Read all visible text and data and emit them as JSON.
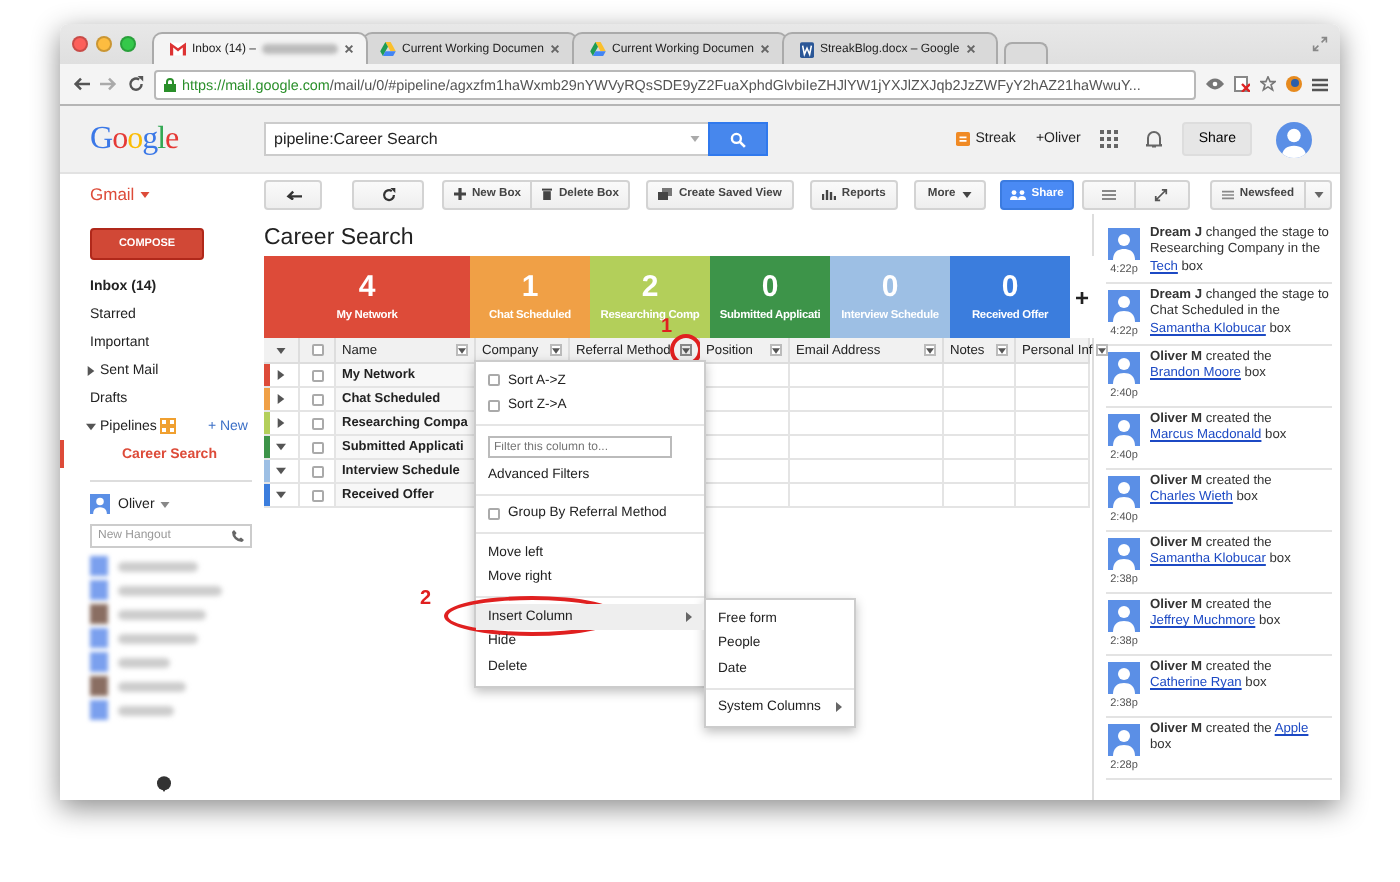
{
  "browser": {
    "tabs": [
      {
        "kind": "mail",
        "title": "Inbox (14) –",
        "selected": true
      },
      {
        "kind": "drive",
        "title": "Current Working Documen",
        "selected": false
      },
      {
        "kind": "drive",
        "title": "Current Working Documen",
        "selected": false
      },
      {
        "kind": "word",
        "title": "StreakBlog.docx – Google",
        "selected": false
      }
    ],
    "url_host": "https://mail.google.com",
    "url_path": "/mail/u/0/#pipeline/agxzfm1haWxmb29nYWVyRQsSDE9yZ2FuaXphdGlvbiIeZHJlYW1jYXJlZXJqb2JzZWFyY2hAZ21haWwuY..."
  },
  "header": {
    "logo": "Google",
    "search_value": "pipeline:Career Search",
    "streak": "Streak",
    "user_link": "+Oliver",
    "share": "Share"
  },
  "toolbar": {
    "app_menu": "Gmail",
    "buttons": [
      {
        "kind": "back"
      },
      {
        "kind": "refresh"
      },
      {
        "kind": "new",
        "label": "New Box"
      },
      {
        "kind": "delete",
        "label": "Delete Box"
      },
      {
        "kind": "view",
        "label": "Create Saved View"
      },
      {
        "kind": "reports",
        "label": "Reports"
      },
      {
        "kind": "more",
        "label": "More"
      },
      {
        "kind": "share",
        "label": "Share"
      },
      {
        "kind": "list"
      },
      {
        "kind": "expand"
      },
      {
        "kind": "newsfeed",
        "label": "Newsfeed"
      },
      {
        "kind": "dropdown"
      }
    ]
  },
  "sidebar": {
    "compose": "COMPOSE",
    "items": [
      {
        "label": "Inbox (14)",
        "unread": true,
        "selected": false
      },
      {
        "label": "Starred",
        "unread": false,
        "selected": false
      },
      {
        "label": "Important",
        "unread": false,
        "selected": false
      },
      {
        "label": "Sent Mail",
        "unread": false,
        "selected": false,
        "expanded": false
      },
      {
        "label": "Drafts",
        "unread": false,
        "selected": false
      }
    ],
    "pipelines": {
      "label": "Pipelines",
      "expanded": true,
      "new_link": "+ New",
      "children": [
        {
          "label": "Career Search",
          "selected": true
        }
      ]
    },
    "hangouts": {
      "user": "Oliver",
      "placeholder": "New Hangout"
    }
  },
  "pipeline": {
    "title": "Career Search",
    "add_stage": "+",
    "select_all": {
      "checked": false
    },
    "stages": [
      {
        "count": "4",
        "label": "My Network",
        "color": "#dd4b39"
      },
      {
        "count": "1",
        "label": "Chat Scheduled",
        "color": "#f0a046"
      },
      {
        "count": "2",
        "label": "Researching Comp",
        "color": "#b3cf5a"
      },
      {
        "count": "0",
        "label": "Submitted Applicati",
        "color": "#3d9449"
      },
      {
        "count": "0",
        "label": "Interview Schedule",
        "color": "#9dbfe4"
      },
      {
        "count": "0",
        "label": "Received Offer",
        "color": "#3b7ddd"
      }
    ],
    "columns": [
      {
        "label": "Name",
        "menu_open": false
      },
      {
        "label": "Company",
        "menu_open": false
      },
      {
        "label": "Referral Method",
        "menu_open": true
      },
      {
        "label": "Position",
        "menu_open": false
      },
      {
        "label": "Email Address",
        "menu_open": false
      },
      {
        "label": "Notes",
        "menu_open": false
      },
      {
        "label": "Personal Inf",
        "menu_open": false
      }
    ],
    "rows": [
      {
        "name": "My Network",
        "color": "#dd4b39",
        "expanded": false,
        "checked": false
      },
      {
        "name": "Chat Scheduled",
        "color": "#f0a046",
        "expanded": false,
        "checked": false
      },
      {
        "name": "Researching Compa",
        "color": "#b3cf5a",
        "expanded": false,
        "checked": false
      },
      {
        "name": "Submitted Applicati",
        "color": "#3d9449",
        "expanded": true,
        "checked": false
      },
      {
        "name": "Interview Schedule",
        "color": "#9dbfe4",
        "expanded": true,
        "checked": false
      },
      {
        "name": "Received Offer",
        "color": "#3b7ddd",
        "expanded": true,
        "checked": false
      }
    ],
    "column_menu": {
      "sections": [
        [
          {
            "kind": "check",
            "label": "Sort A->Z",
            "checked": false
          },
          {
            "kind": "check",
            "label": "Sort Z->A",
            "checked": false
          }
        ],
        [
          {
            "kind": "field",
            "placeholder": "Filter this column to..."
          },
          {
            "kind": "action",
            "label": "Advanced Filters",
            "highlighted": false
          }
        ],
        [
          {
            "kind": "check",
            "label": "Group By Referral Method",
            "checked": false
          }
        ],
        [
          {
            "kind": "action",
            "label": "Move left",
            "highlighted": false
          },
          {
            "kind": "action",
            "label": "Move right",
            "highlighted": false
          }
        ],
        [
          {
            "kind": "submenu",
            "label": "Insert Column",
            "highlighted": true
          },
          {
            "kind": "action",
            "label": "Hide",
            "highlighted": false
          },
          {
            "kind": "action",
            "label": "Delete",
            "highlighted": false
          }
        ]
      ]
    },
    "submenu": {
      "sections": [
        [
          {
            "kind": "action",
            "label": "Free form",
            "highlighted": false
          },
          {
            "kind": "action",
            "label": "People",
            "highlighted": false
          },
          {
            "kind": "action",
            "label": "Date",
            "highlighted": false
          }
        ],
        [
          {
            "kind": "submenu",
            "label": "System Columns",
            "highlighted": false
          }
        ]
      ]
    },
    "annotations": [
      {
        "kind": "circle",
        "label": "1"
      },
      {
        "kind": "ellipse",
        "label": "2"
      }
    ]
  },
  "feed": {
    "entries": [
      {
        "time": "4:22p",
        "actor": "Dream J",
        "action": " changed the stage to Researching Company in the ",
        "link": "Tech",
        "tail": " box"
      },
      {
        "time": "4:22p",
        "actor": "Dream J",
        "action": " changed the stage to Chat Scheduled in the ",
        "link": "Samantha Klobucar",
        "tail": " box"
      },
      {
        "time": "2:40p",
        "actor": "Oliver M",
        "action": " created the ",
        "link": "Brandon Moore",
        "tail": " box"
      },
      {
        "time": "2:40p",
        "actor": "Oliver M",
        "action": " created the ",
        "link": "Marcus Macdonald",
        "tail": " box"
      },
      {
        "time": "2:40p",
        "actor": "Oliver M",
        "action": " created the ",
        "link": "Charles Wieth",
        "tail": " box"
      },
      {
        "time": "2:38p",
        "actor": "Oliver M",
        "action": " created the ",
        "link": "Samantha Klobucar",
        "tail": " box"
      },
      {
        "time": "2:38p",
        "actor": "Oliver M",
        "action": " created the ",
        "link": "Jeffrey Muchmore",
        "tail": " box"
      },
      {
        "time": "2:38p",
        "actor": "Oliver M",
        "action": " created the ",
        "link": "Catherine Ryan",
        "tail": " box"
      },
      {
        "time": "2:28p",
        "actor": "Oliver M",
        "action": " created the ",
        "link": "Apple",
        "tail": " box"
      }
    ]
  }
}
